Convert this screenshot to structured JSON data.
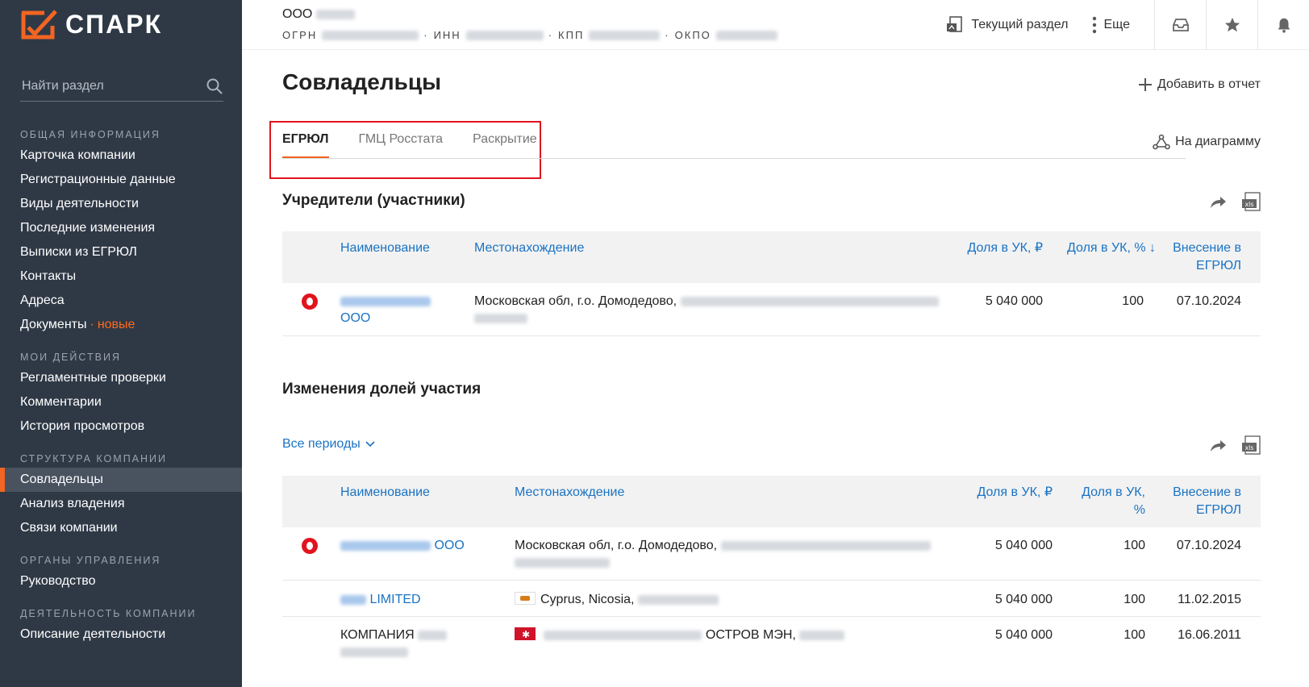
{
  "app": {
    "logo_text": "СПАРК",
    "search_placeholder": "Найти раздел"
  },
  "sidebar": {
    "groups": [
      {
        "heading": "ОБЩАЯ ИНФОРМАЦИЯ",
        "items": [
          "Карточка компании",
          "Регистрационные данные",
          "Виды деятельности",
          "Последние изменения",
          "Выписки из ЕГРЮЛ",
          "Контакты",
          "Адреса"
        ]
      },
      {
        "heading": "МОИ ДЕЙСТВИЯ",
        "items": [
          "Регламентные проверки",
          "Комментарии",
          "История просмотров"
        ]
      },
      {
        "heading": "СТРУКТУРА КОМПАНИИ",
        "items": [
          "Совладельцы",
          "Анализ владения",
          "Связи компании"
        ]
      },
      {
        "heading": "ОРГАНЫ УПРАВЛЕНИЯ",
        "items": [
          "Руководство"
        ]
      },
      {
        "heading": "ДЕЯТЕЛЬНОСТЬ КОМПАНИИ",
        "items": [
          "Описание деятельности"
        ]
      }
    ],
    "documents_label": "Документы",
    "documents_badge": "новые",
    "active_item": "Совладельцы"
  },
  "header": {
    "company_prefix": "ООО",
    "ogrn_label": "ОГРН",
    "inn_label": "ИНН",
    "kpp_label": "КПП",
    "okpo_label": "ОКПО",
    "current_section": "Текущий раздел",
    "more": "Еще"
  },
  "page": {
    "title": "Совладельцы",
    "add_to_report": "Добавить в отчет",
    "to_diagram": "На диаграмму",
    "tabs": [
      "ЕГРЮЛ",
      "ГМЦ Росстата",
      "Раскрытие"
    ],
    "active_tab": "ЕГРЮЛ"
  },
  "founders": {
    "title": "Учредители (участники)",
    "columns": [
      "Наименование",
      "Местонахождение",
      "Доля в УК, ₽",
      "Доля в УК, % ↓",
      "Внесение в ЕГРЮЛ"
    ],
    "rows": [
      {
        "name_suffix": "ООО",
        "location": "Московская обл, г.о. Домодедово,",
        "share_rub": "5 040 000",
        "share_pct": "100",
        "date": "07.10.2024"
      }
    ]
  },
  "changes": {
    "title": "Изменения долей участия",
    "period": "Все периоды",
    "columns": [
      "Наименование",
      "Местонахождение",
      "Доля в УК, ₽",
      "Доля в УК, %",
      "Внесение в ЕГРЮЛ"
    ],
    "rows": [
      {
        "name_suffix": "ООО",
        "location": "Московская обл, г.о. Домодедово,",
        "share_rub": "5 040 000",
        "share_pct": "100",
        "date": "07.10.2024"
      },
      {
        "name_suffix": "LIMITED",
        "location": "Cyprus, Nicosia,",
        "share_rub": "5 040 000",
        "share_pct": "100",
        "date": "11.02.2015"
      },
      {
        "name_prefix": "КОМПАНИЯ",
        "location": "ОСТРОВ МЭН,",
        "share_rub": "5 040 000",
        "share_pct": "100",
        "date": "16.06.2011"
      }
    ]
  },
  "colors": {
    "accent": "#f26522",
    "link": "#1a73c4",
    "sidebar_bg": "#2f3946",
    "highlight": "#e1141e"
  }
}
